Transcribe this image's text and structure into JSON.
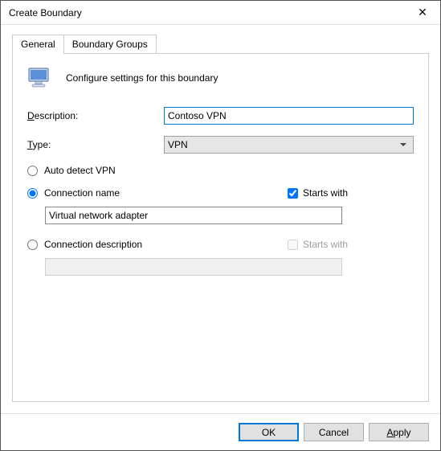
{
  "window": {
    "title": "Create Boundary"
  },
  "tabs": {
    "general": "General",
    "groups": "Boundary Groups"
  },
  "header": {
    "text": "Configure settings for this boundary"
  },
  "form": {
    "description_label": "Description:",
    "description_value": "Contoso VPN",
    "type_label": "Type:",
    "type_value": "VPN"
  },
  "options": {
    "auto_detect": "Auto detect VPN",
    "connection_name": "Connection name",
    "starts_with_cn": "Starts with",
    "connection_name_value": "Virtual network adapter",
    "connection_desc": "Connection description",
    "starts_with_cd": "Starts with",
    "connection_desc_value": ""
  },
  "buttons": {
    "ok": "OK",
    "cancel": "Cancel",
    "apply": "Apply"
  },
  "accel": {
    "desc": "D",
    "type": "T",
    "apply": "A"
  }
}
